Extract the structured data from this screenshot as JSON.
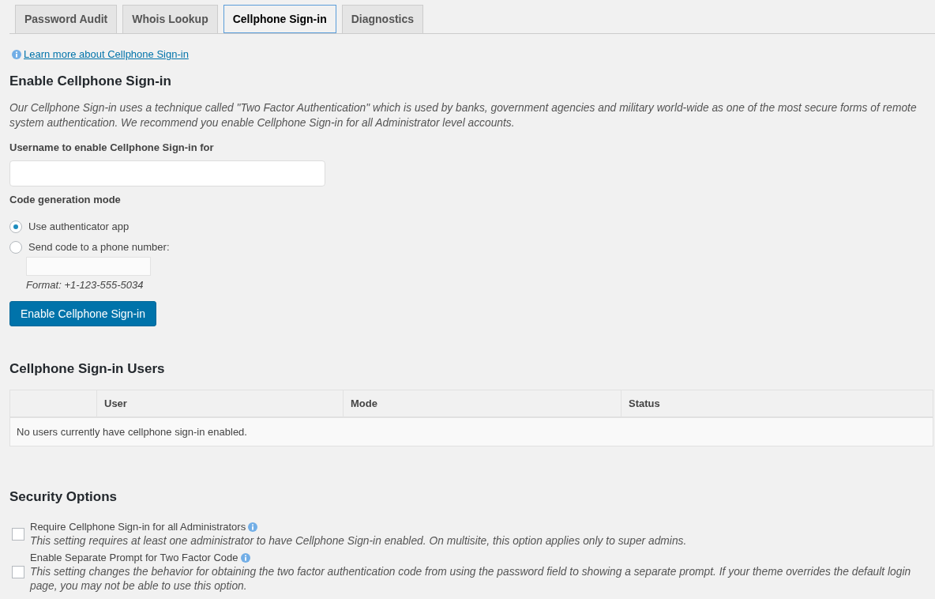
{
  "tabs": [
    {
      "label": "Password Audit",
      "selected": false
    },
    {
      "label": "Whois Lookup",
      "selected": false
    },
    {
      "label": "Cellphone Sign-in",
      "selected": true
    },
    {
      "label": "Diagnostics",
      "selected": false
    }
  ],
  "help_link": {
    "text": "Learn more about Cellphone Sign-in"
  },
  "enable_section": {
    "title": "Enable Cellphone Sign-in",
    "description": "Our Cellphone Sign-in uses a technique called \"Two Factor Authentication\" which is used by banks, government agencies and military world-wide as one of the most secure forms of remote system authentication. We recommend you enable Cellphone Sign-in for all Administrator level accounts.",
    "username_label": "Username to enable Cellphone Sign-in for",
    "mode_label": "Code generation mode",
    "modes": [
      {
        "label": "Use authenticator app",
        "selected": true
      },
      {
        "label": "Send code to a phone number:",
        "selected": false
      }
    ],
    "phone_format": "Format: +1-123-555-5034",
    "button": "Enable Cellphone Sign-in"
  },
  "users_section": {
    "title": "Cellphone Sign-in Users",
    "columns": [
      "User",
      "Mode",
      "Status"
    ],
    "empty_message": "No users currently have cellphone sign-in enabled."
  },
  "security_section": {
    "title": "Security Options",
    "options": [
      {
        "label": "Require Cellphone Sign-in for all Administrators",
        "description": "This setting requires at least one administrator to have Cellphone Sign-in enabled. On multisite, this option applies only to super admins.",
        "checked": false
      },
      {
        "label": "Enable Separate Prompt for Two Factor Code",
        "description": "This setting changes the behavior for obtaining the two factor authentication code from using the password field to showing a separate prompt. If your theme overrides the default login page, you may not be able to use this option.",
        "checked": false
      }
    ]
  }
}
